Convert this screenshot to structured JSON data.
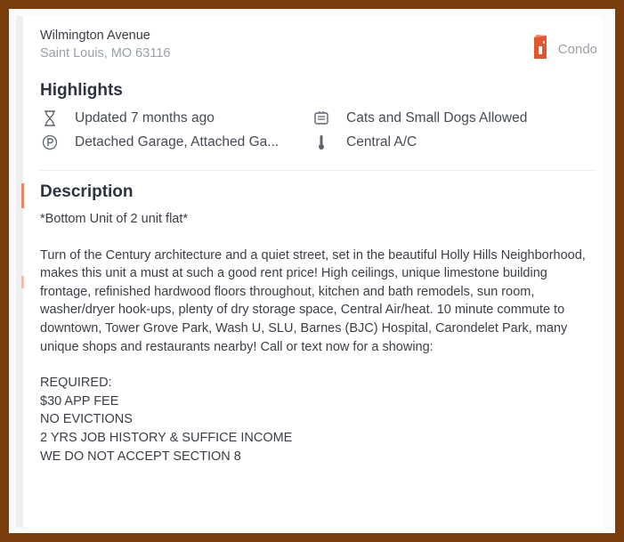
{
  "listing": {
    "street": "Wilmington Avenue",
    "city_state_zip": "Saint Louis, MO 63116",
    "property_type": "Condo",
    "property_type_icon": "condo-building-icon",
    "accent_color": "#e4572e"
  },
  "highlights": {
    "title": "Highlights",
    "items": [
      {
        "icon": "hourglass-icon",
        "label": "Updated 7 months ago"
      },
      {
        "icon": "pet-icon",
        "label": "Cats and Small Dogs Allowed"
      },
      {
        "icon": "parking-icon",
        "label": "Detached Garage, Attached Ga..."
      },
      {
        "icon": "thermometer-icon",
        "label": "Central A/C"
      }
    ]
  },
  "description": {
    "title": "Description",
    "subtitle": "*Bottom Unit of 2 unit flat*",
    "body": "Turn of the Century architecture and a quiet street, set in the beautiful Holly Hills Neighborhood, makes this unit a must at such a good rent price! High ceilings, unique limestone building frontage, refinished hardwood floors throughout, kitchen and bath remodels, sun room, washer/dryer hook-ups, plenty of dry storage space, Central Air/heat. 10 minute commute to downtown, Tower Grove Park, Wash U, SLU, Barnes (BJC) Hospital, Carondelet Park, many unique shops and restaurants nearby! Call or text now for a showing:",
    "requirements": [
      "REQUIRED:",
      "$30 APP FEE",
      "NO EVICTIONS",
      "2 YRS JOB HISTORY & SUFFICE INCOME",
      "WE DO NOT ACCEPT SECTION 8"
    ]
  }
}
